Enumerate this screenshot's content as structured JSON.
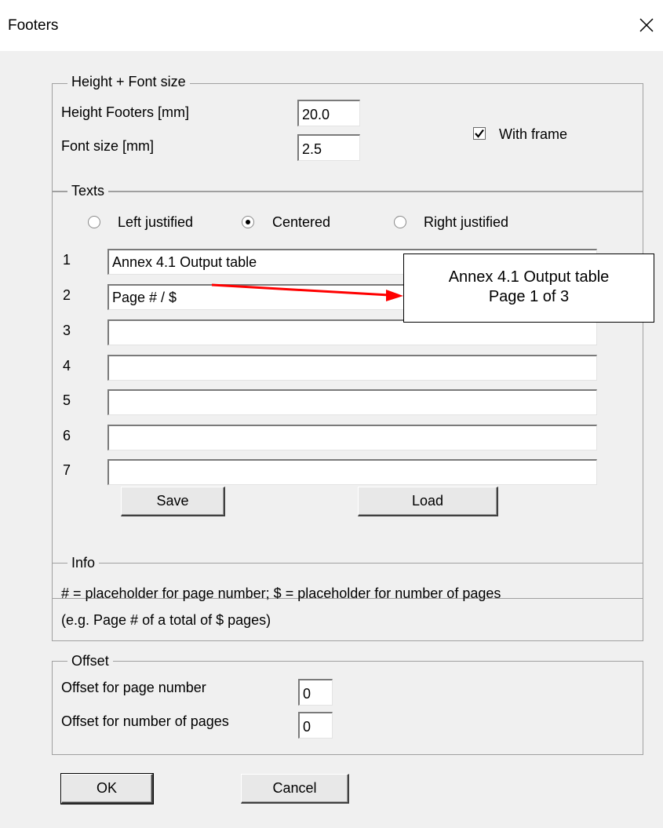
{
  "window": {
    "title": "Footers",
    "close_glyph": "✕"
  },
  "height_font": {
    "legend": "Height + Font size",
    "height_label": "Height Footers [mm]",
    "height_value": "20.0",
    "font_label": "Font size [mm]",
    "font_value": "2.5",
    "with_frame_label": "With frame",
    "with_frame_checked": true
  },
  "texts": {
    "legend": "Texts",
    "alignment": [
      {
        "label": "Left justified",
        "selected": false
      },
      {
        "label": "Centered",
        "selected": true
      },
      {
        "label": "Right justified",
        "selected": false
      }
    ],
    "lines": [
      {
        "num": "1",
        "value": "Annex 4.1 Output table"
      },
      {
        "num": "2",
        "value": "Page # / $"
      },
      {
        "num": "3",
        "value": ""
      },
      {
        "num": "4",
        "value": ""
      },
      {
        "num": "5",
        "value": ""
      },
      {
        "num": "6",
        "value": ""
      },
      {
        "num": "7",
        "value": ""
      }
    ],
    "save_label": "Save",
    "load_label": "Load"
  },
  "callout": {
    "line1": "Annex 4.1 Output table",
    "line2": "Page 1 of 3",
    "arrow_color": "#ff0000"
  },
  "info": {
    "legend": "Info",
    "line1": "# = placeholder for page number; $ = placeholder for number of pages",
    "line2": "(e.g. Page # of a total of $ pages)"
  },
  "offset": {
    "legend": "Offset",
    "page_number_label": "Offset for page number",
    "page_number_value": "0",
    "num_pages_label": "Offset for number of pages",
    "num_pages_value": "0"
  },
  "buttons": {
    "ok_label": "OK",
    "cancel_label": "Cancel"
  }
}
